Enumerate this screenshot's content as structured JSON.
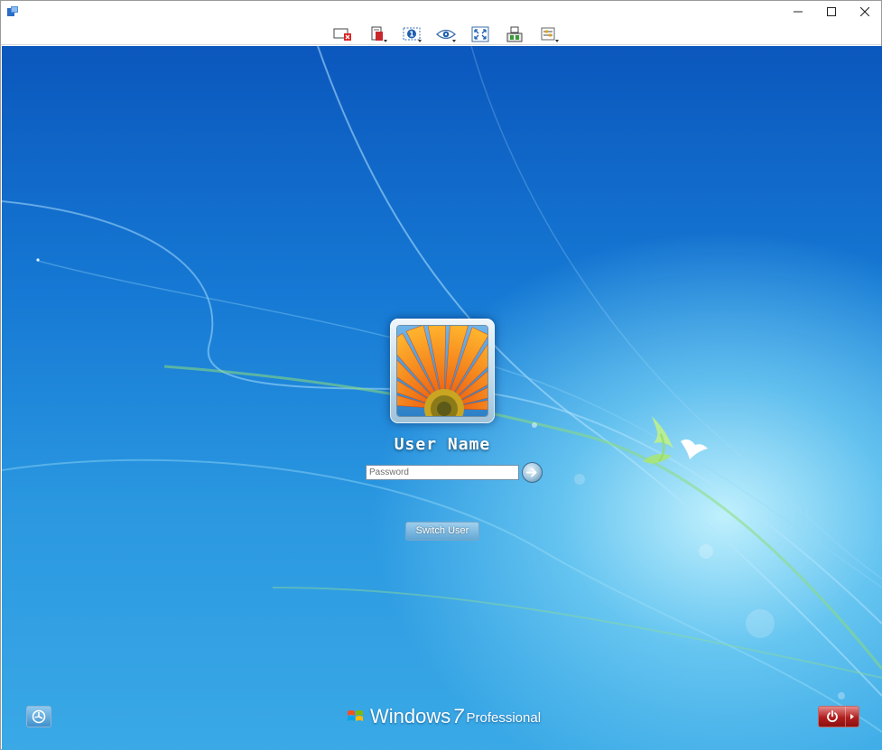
{
  "window": {
    "controls": {
      "minimize_glyph": "—",
      "maximize_glyph": "☐",
      "close_glyph": "✕"
    }
  },
  "toolbar": {
    "buttons": [
      {
        "icon": "disconnect-icon"
      },
      {
        "icon": "clipboard-icon"
      },
      {
        "icon": "monitor-select-icon"
      },
      {
        "icon": "view-only-icon"
      },
      {
        "icon": "fullscreen-icon"
      },
      {
        "icon": "actions-icon"
      },
      {
        "icon": "settings-icon"
      }
    ]
  },
  "login": {
    "user_name": "User Name",
    "password_placeholder": "Password",
    "password_value": "",
    "switch_user_label": "Switch User"
  },
  "branding": {
    "word": "Windows",
    "version": "7",
    "edition": "Professional"
  },
  "colors": {
    "desktop_top": "#0b57bd",
    "desktop_bottom": "#3aa9e6",
    "power_red": "#b21f1f"
  }
}
